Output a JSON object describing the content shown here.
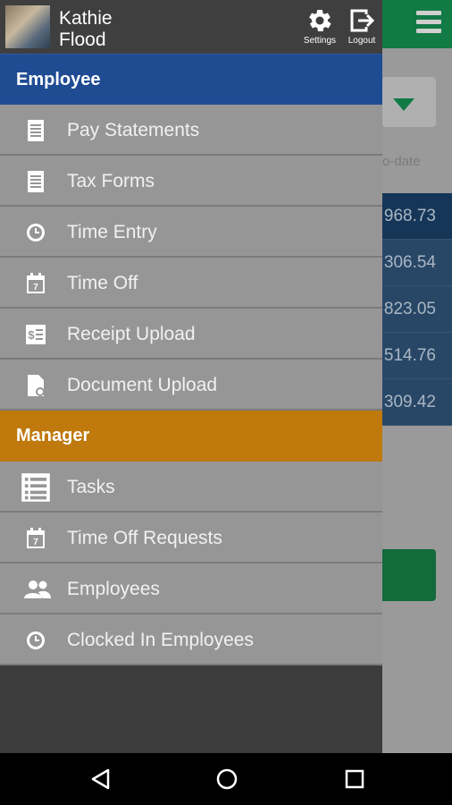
{
  "user": {
    "first_name": "Kathie",
    "last_name": "Flood"
  },
  "header_actions": {
    "settings_label": "Settings",
    "logout_label": "Logout"
  },
  "employee_section": {
    "title": "Employee",
    "color": "#1f4b93",
    "items": [
      {
        "label": "Pay Statements",
        "icon": "document-icon"
      },
      {
        "label": "Tax Forms",
        "icon": "document-icon"
      },
      {
        "label": "Time Entry",
        "icon": "clock-icon"
      },
      {
        "label": "Time Off",
        "icon": "calendar-icon"
      },
      {
        "label": "Receipt Upload",
        "icon": "receipt-icon"
      },
      {
        "label": "Document Upload",
        "icon": "document-upload-icon"
      }
    ]
  },
  "manager_section": {
    "title": "Manager",
    "color": "#c0790d",
    "items": [
      {
        "label": "Tasks",
        "icon": "task-list-icon"
      },
      {
        "label": "Time Off Requests",
        "icon": "calendar-icon"
      },
      {
        "label": "Employees",
        "icon": "people-icon"
      },
      {
        "label": "Clocked In Employees",
        "icon": "clock-icon"
      }
    ]
  },
  "calendar_day": "7",
  "background": {
    "ytd_label": "o-date",
    "amounts": [
      "968.73",
      "306.54",
      "823.05",
      "514.76",
      "309.42"
    ],
    "appbar_color": "#127a45"
  },
  "nav": {
    "back": "back-icon",
    "home": "home-icon",
    "recent": "recent-apps-icon"
  }
}
